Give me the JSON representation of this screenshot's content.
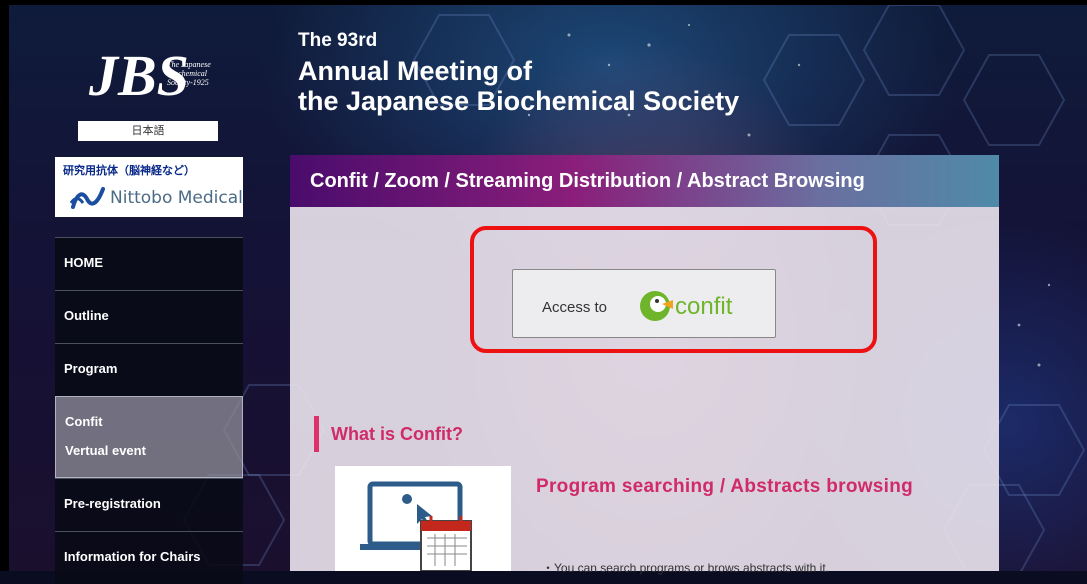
{
  "header": {
    "line1": "The 93rd",
    "line2": "Annual Meeting of",
    "line3": "the Japanese Biochemical Society"
  },
  "sidebar": {
    "logo_text": "The Japanese Biochemical Society-1925",
    "language_button": "日本語",
    "ad": {
      "title": "研究用抗体（脳神経など）",
      "company": "Nittobo Medical"
    },
    "items": [
      {
        "label": "HOME"
      },
      {
        "label": "Outline"
      },
      {
        "label": "Program"
      },
      {
        "label_line1": "Confit",
        "label_line2": "Vertual event"
      },
      {
        "label": "Pre-registration"
      },
      {
        "label": "Information for Chairs"
      }
    ]
  },
  "main": {
    "panel_title": "Confit / Zoom / Streaming Distribution / Abstract Browsing",
    "access_button": {
      "label": "Access to",
      "logo_text": "confit"
    },
    "section_title": "What is Confit?",
    "feature": {
      "title": "Program searching / Abstracts browsing",
      "text": "・You can search programs or brows abstracts with it."
    }
  },
  "colors": {
    "accent_pink": "#d02a6a",
    "highlight_red": "#ee1111",
    "confit_green": "#6fb52c",
    "confit_orange": "#f2a31c"
  }
}
